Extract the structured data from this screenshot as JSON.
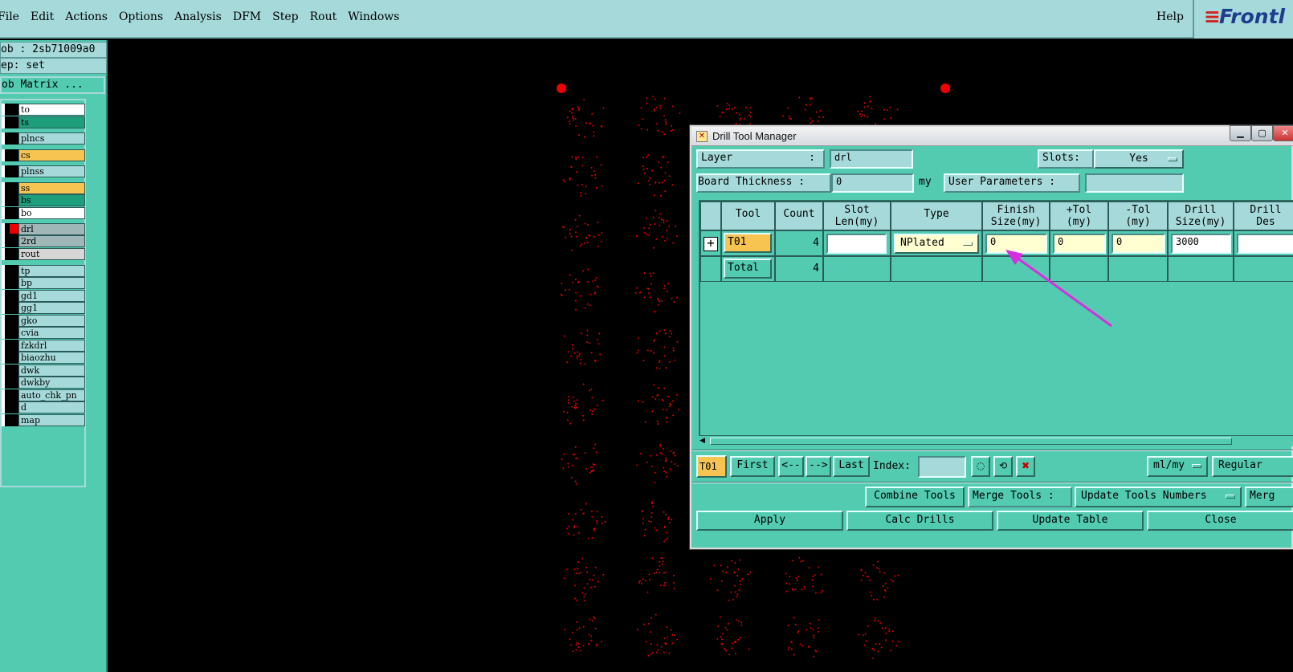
{
  "menubar": {
    "items": [
      "File",
      "Edit",
      "Actions",
      "Options",
      "Analysis",
      "DFM",
      "Step",
      "Rout",
      "Windows"
    ],
    "help": "Help",
    "logo": "Frontl"
  },
  "leftpanel": {
    "job": "ob : 2sb71009a0",
    "step": "ep: set",
    "matrix_button": "ob Matrix ...",
    "layers": [
      {
        "name": "to",
        "color": "#ffffff"
      },
      {
        "name": "ts",
        "color": "#1f9e7c"
      },
      {
        "name": "plncs",
        "color": "#a6dada"
      },
      {
        "name": "cs",
        "color": "#f7c451"
      },
      {
        "name": "plnss",
        "color": "#a6dada"
      },
      {
        "name": "ss",
        "color": "#f7c451"
      },
      {
        "name": "bs",
        "color": "#1f9e7c"
      },
      {
        "name": "bo",
        "color": "#ffffff"
      },
      {
        "name": "drl",
        "color": "#9fb7b7"
      },
      {
        "name": "2rd",
        "color": "#9fb7b7"
      },
      {
        "name": "rout",
        "color": "#d6d6d6"
      },
      {
        "name": "tp",
        "color": "#a6dada"
      },
      {
        "name": "bp",
        "color": "#a6dada"
      },
      {
        "name": "gd1",
        "color": "#a6dada"
      },
      {
        "name": "gg1",
        "color": "#a6dada"
      },
      {
        "name": "gko",
        "color": "#a6dada"
      },
      {
        "name": "cvia",
        "color": "#a6dada"
      },
      {
        "name": "fzkdrl",
        "color": "#a6dada"
      },
      {
        "name": "biaozhu",
        "color": "#a6dada"
      },
      {
        "name": "dwk",
        "color": "#a6dada"
      },
      {
        "name": "dwkby",
        "color": "#a6dada"
      },
      {
        "name": "auto_chk_pn",
        "color": "#a6dada"
      },
      {
        "name": "d",
        "color": "#a6dada"
      },
      {
        "name": "map",
        "color": "#a6dada"
      }
    ]
  },
  "dialog": {
    "title": "Drill Tool Manager",
    "layer_label": "Layer",
    "layer_colon": ":",
    "layer_value": "drl",
    "slots_label": "Slots:",
    "slots_value": "Yes",
    "board_thickness_label": "Board Thickness :",
    "board_thickness_value": "0",
    "board_thickness_unit": "my",
    "user_params_label": "User Parameters :",
    "user_params_value": "",
    "table": {
      "headers": [
        {
          "line1": "Tool",
          "line2": ""
        },
        {
          "line1": "Count",
          "line2": ""
        },
        {
          "line1": "Slot",
          "line2": "Len(my)"
        },
        {
          "line1": "Type",
          "line2": ""
        },
        {
          "line1": "Finish",
          "line2": "Size(my)"
        },
        {
          "line1": "+Tol",
          "line2": "(my)"
        },
        {
          "line1": "-Tol",
          "line2": "(my)"
        },
        {
          "line1": "Drill",
          "line2": "Size(my)"
        },
        {
          "line1": "Drill",
          "line2": "Des"
        }
      ],
      "row": {
        "tool": "T01",
        "count": "4",
        "slot_len": "",
        "type": "NPlated",
        "finish_size": "0",
        "plus_tol": "0",
        "minus_tol": "0",
        "drill_size": "3000",
        "drill_des": ""
      },
      "total_label": "Total",
      "total_count": "4"
    },
    "nav": {
      "current_tool": "T01",
      "first": "First",
      "prev": "<--",
      "next": "-->",
      "last": "Last",
      "index_label": "Index:",
      "index_value": "",
      "units": "ml/my",
      "mode": "Regular"
    },
    "tools_row": {
      "combine": "Combine Tools",
      "merge_label": "Merge Tools :",
      "update_numbers": "Update Tools Numbers",
      "merge_trunc": "Merg"
    },
    "bottom": {
      "apply": "Apply",
      "calc": "Calc Drills",
      "update_table": "Update Table",
      "close": "Close"
    }
  },
  "colors": {
    "panel": "#52cbb0",
    "field": "#a6dada",
    "menubar": "#a6dada",
    "highlight": "#f7c451",
    "arrow": "#d62fe0",
    "drill_dot": "#e00000"
  }
}
